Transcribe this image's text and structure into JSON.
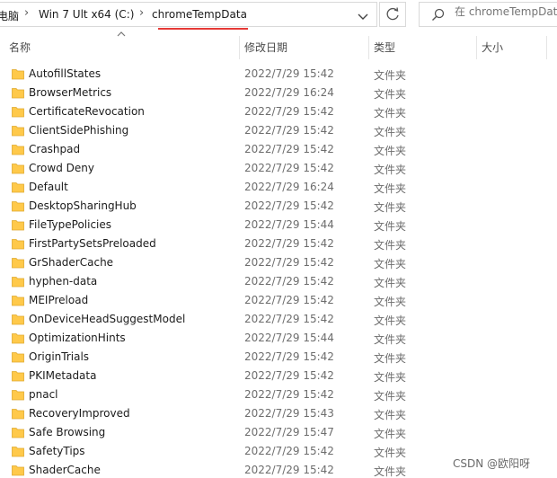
{
  "breadcrumb": {
    "items": [
      "电脑",
      "Win 7 Ult x64 (C:)",
      "chromeTempData"
    ]
  },
  "search": {
    "placeholder": "在 chromeTempData"
  },
  "columns": {
    "name": "名称",
    "modified": "修改日期",
    "type": "类型",
    "size": "大小"
  },
  "files": [
    {
      "name": "AutofillStates",
      "modified": "2022/7/29 15:42",
      "type": "文件夹"
    },
    {
      "name": "BrowserMetrics",
      "modified": "2022/7/29 16:24",
      "type": "文件夹"
    },
    {
      "name": "CertificateRevocation",
      "modified": "2022/7/29 15:42",
      "type": "文件夹"
    },
    {
      "name": "ClientSidePhishing",
      "modified": "2022/7/29 15:42",
      "type": "文件夹"
    },
    {
      "name": "Crashpad",
      "modified": "2022/7/29 15:42",
      "type": "文件夹"
    },
    {
      "name": "Crowd Deny",
      "modified": "2022/7/29 15:42",
      "type": "文件夹"
    },
    {
      "name": "Default",
      "modified": "2022/7/29 16:24",
      "type": "文件夹"
    },
    {
      "name": "DesktopSharingHub",
      "modified": "2022/7/29 15:42",
      "type": "文件夹"
    },
    {
      "name": "FileTypePolicies",
      "modified": "2022/7/29 15:44",
      "type": "文件夹"
    },
    {
      "name": "FirstPartySetsPreloaded",
      "modified": "2022/7/29 15:42",
      "type": "文件夹"
    },
    {
      "name": "GrShaderCache",
      "modified": "2022/7/29 15:42",
      "type": "文件夹"
    },
    {
      "name": "hyphen-data",
      "modified": "2022/7/29 15:42",
      "type": "文件夹"
    },
    {
      "name": "MEIPreload",
      "modified": "2022/7/29 15:42",
      "type": "文件夹"
    },
    {
      "name": "OnDeviceHeadSuggestModel",
      "modified": "2022/7/29 15:42",
      "type": "文件夹"
    },
    {
      "name": "OptimizationHints",
      "modified": "2022/7/29 15:44",
      "type": "文件夹"
    },
    {
      "name": "OriginTrials",
      "modified": "2022/7/29 15:42",
      "type": "文件夹"
    },
    {
      "name": "PKIMetadata",
      "modified": "2022/7/29 15:42",
      "type": "文件夹"
    },
    {
      "name": "pnacl",
      "modified": "2022/7/29 15:42",
      "type": "文件夹"
    },
    {
      "name": "RecoveryImproved",
      "modified": "2022/7/29 15:43",
      "type": "文件夹"
    },
    {
      "name": "Safe Browsing",
      "modified": "2022/7/29 15:47",
      "type": "文件夹"
    },
    {
      "name": "SafetyTips",
      "modified": "2022/7/29 15:42",
      "type": "文件夹"
    },
    {
      "name": "ShaderCache",
      "modified": "2022/7/29 15:42",
      "type": "文件夹"
    }
  ],
  "watermark": "CSDN @欧阳呀",
  "icons": {
    "folder": "folder-icon",
    "search": "search-icon",
    "refresh": "refresh-icon",
    "dropdown": "chevron-down-icon",
    "separator": "chevron-right-icon",
    "sort": "sort-ascending-icon"
  },
  "colors": {
    "folder": "#FFC94A",
    "highlight_underline": "#E53935"
  }
}
